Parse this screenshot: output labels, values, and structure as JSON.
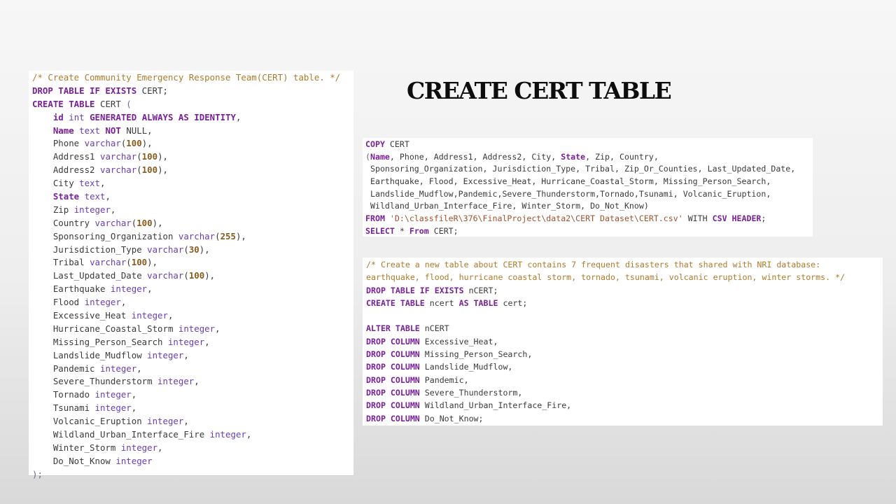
{
  "title": "CREATE CERT TABLE",
  "colors": {
    "keyword": "#7a1f9c",
    "comment": "#b07a2a",
    "type": "#6a3db8",
    "number": "#8a5a1a",
    "plain": "#3b3b3b",
    "string": "#a0522d"
  },
  "panels": [
    {
      "name": "create-table-code",
      "lines": [
        [
          {
            "t": "/* Create Community Emergency Response Team(CERT) table. */",
            "c": "cm"
          }
        ],
        [
          {
            "t": "DROP TABLE IF EXISTS",
            "c": "kw"
          },
          {
            "t": " CERT;",
            "c": "pl"
          }
        ],
        [
          {
            "t": "CREATE TABLE",
            "c": "kw"
          },
          {
            "t": " CERT ",
            "c": "pl"
          },
          {
            "t": "(",
            "c": "pn"
          }
        ],
        [
          {
            "t": "    ",
            "c": "pl"
          },
          {
            "t": "id",
            "c": "kw"
          },
          {
            "t": " ",
            "c": "pl"
          },
          {
            "t": "int",
            "c": "ty"
          },
          {
            "t": " ",
            "c": "pl"
          },
          {
            "t": "GENERATED ALWAYS AS IDENTITY",
            "c": "kw"
          },
          {
            "t": ",",
            "c": "pl"
          }
        ],
        [
          {
            "t": "    ",
            "c": "pl"
          },
          {
            "t": "Name",
            "c": "kw"
          },
          {
            "t": " ",
            "c": "pl"
          },
          {
            "t": "text",
            "c": "ty"
          },
          {
            "t": " ",
            "c": "pl"
          },
          {
            "t": "NOT",
            "c": "kw"
          },
          {
            "t": " NULL,",
            "c": "pl"
          }
        ],
        [
          {
            "t": "    Phone ",
            "c": "pl"
          },
          {
            "t": "varchar",
            "c": "ty"
          },
          {
            "t": "(",
            "c": "pl"
          },
          {
            "t": "100",
            "c": "nm"
          },
          {
            "t": "),",
            "c": "pl"
          }
        ],
        [
          {
            "t": "    Address1 ",
            "c": "pl"
          },
          {
            "t": "varchar",
            "c": "ty"
          },
          {
            "t": "(",
            "c": "pl"
          },
          {
            "t": "100",
            "c": "nm"
          },
          {
            "t": "),",
            "c": "pl"
          }
        ],
        [
          {
            "t": "    Address2 ",
            "c": "pl"
          },
          {
            "t": "varchar",
            "c": "ty"
          },
          {
            "t": "(",
            "c": "pl"
          },
          {
            "t": "100",
            "c": "nm"
          },
          {
            "t": "),",
            "c": "pl"
          }
        ],
        [
          {
            "t": "    City ",
            "c": "pl"
          },
          {
            "t": "text",
            "c": "ty"
          },
          {
            "t": ",",
            "c": "pl"
          }
        ],
        [
          {
            "t": "    ",
            "c": "pl"
          },
          {
            "t": "State",
            "c": "kw"
          },
          {
            "t": " ",
            "c": "pl"
          },
          {
            "t": "text",
            "c": "ty"
          },
          {
            "t": ",",
            "c": "pl"
          }
        ],
        [
          {
            "t": "    Zip ",
            "c": "pl"
          },
          {
            "t": "integer",
            "c": "ty"
          },
          {
            "t": ",",
            "c": "pl"
          }
        ],
        [
          {
            "t": "    Country ",
            "c": "pl"
          },
          {
            "t": "varchar",
            "c": "ty"
          },
          {
            "t": "(",
            "c": "pl"
          },
          {
            "t": "100",
            "c": "nm"
          },
          {
            "t": "),",
            "c": "pl"
          }
        ],
        [
          {
            "t": "    Sponsoring_Organization ",
            "c": "pl"
          },
          {
            "t": "varchar",
            "c": "ty"
          },
          {
            "t": "(",
            "c": "pl"
          },
          {
            "t": "255",
            "c": "nm"
          },
          {
            "t": "),",
            "c": "pl"
          }
        ],
        [
          {
            "t": "    Jurisdiction_Type ",
            "c": "pl"
          },
          {
            "t": "varchar",
            "c": "ty"
          },
          {
            "t": "(",
            "c": "pl"
          },
          {
            "t": "30",
            "c": "nm"
          },
          {
            "t": "),",
            "c": "pl"
          }
        ],
        [
          {
            "t": "    Tribal ",
            "c": "pl"
          },
          {
            "t": "varchar",
            "c": "ty"
          },
          {
            "t": "(",
            "c": "pl"
          },
          {
            "t": "100",
            "c": "nm"
          },
          {
            "t": "),",
            "c": "pl"
          }
        ],
        [
          {
            "t": "    Last_Updated_Date ",
            "c": "pl"
          },
          {
            "t": "varchar",
            "c": "ty"
          },
          {
            "t": "(",
            "c": "pl"
          },
          {
            "t": "100",
            "c": "nm"
          },
          {
            "t": "),",
            "c": "pl"
          }
        ],
        [
          {
            "t": "    Earthquake ",
            "c": "pl"
          },
          {
            "t": "integer",
            "c": "ty"
          },
          {
            "t": ",",
            "c": "pl"
          }
        ],
        [
          {
            "t": "    Flood ",
            "c": "pl"
          },
          {
            "t": "integer",
            "c": "ty"
          },
          {
            "t": ",",
            "c": "pl"
          }
        ],
        [
          {
            "t": "    Excessive_Heat ",
            "c": "pl"
          },
          {
            "t": "integer",
            "c": "ty"
          },
          {
            "t": ",",
            "c": "pl"
          }
        ],
        [
          {
            "t": "    Hurricane_Coastal_Storm ",
            "c": "pl"
          },
          {
            "t": "integer",
            "c": "ty"
          },
          {
            "t": ",",
            "c": "pl"
          }
        ],
        [
          {
            "t": "    Missing_Person_Search ",
            "c": "pl"
          },
          {
            "t": "integer",
            "c": "ty"
          },
          {
            "t": ",",
            "c": "pl"
          }
        ],
        [
          {
            "t": "    Landslide_Mudflow ",
            "c": "pl"
          },
          {
            "t": "integer",
            "c": "ty"
          },
          {
            "t": ",",
            "c": "pl"
          }
        ],
        [
          {
            "t": "    Pandemic ",
            "c": "pl"
          },
          {
            "t": "integer",
            "c": "ty"
          },
          {
            "t": ",",
            "c": "pl"
          }
        ],
        [
          {
            "t": "    Severe_Thunderstorm ",
            "c": "pl"
          },
          {
            "t": "integer",
            "c": "ty"
          },
          {
            "t": ",",
            "c": "pl"
          }
        ],
        [
          {
            "t": "    Tornado ",
            "c": "pl"
          },
          {
            "t": "integer",
            "c": "ty"
          },
          {
            "t": ",",
            "c": "pl"
          }
        ],
        [
          {
            "t": "    Tsunami ",
            "c": "pl"
          },
          {
            "t": "integer",
            "c": "ty"
          },
          {
            "t": ",",
            "c": "pl"
          }
        ],
        [
          {
            "t": "    Volcanic_Eruption ",
            "c": "pl"
          },
          {
            "t": "integer",
            "c": "ty"
          },
          {
            "t": ",",
            "c": "pl"
          }
        ],
        [
          {
            "t": "    Wildland_Urban_Interface_Fire ",
            "c": "pl"
          },
          {
            "t": "integer",
            "c": "ty"
          },
          {
            "t": ",",
            "c": "pl"
          }
        ],
        [
          {
            "t": "    Winter_Storm ",
            "c": "pl"
          },
          {
            "t": "integer",
            "c": "ty"
          },
          {
            "t": ",",
            "c": "pl"
          }
        ],
        [
          {
            "t": "    Do_Not_Know ",
            "c": "pl"
          },
          {
            "t": "integer",
            "c": "ty"
          }
        ],
        [
          {
            "t": ");",
            "c": "pn"
          }
        ]
      ]
    },
    {
      "name": "copy-code",
      "lines": [
        [
          {
            "t": "COPY",
            "c": "kw"
          },
          {
            "t": " CERT",
            "c": "pl"
          }
        ],
        [
          {
            "t": "(",
            "c": "pn"
          },
          {
            "t": "Name",
            "c": "kw"
          },
          {
            "t": ", Phone, Address1, Address2, City, ",
            "c": "pl"
          },
          {
            "t": "State",
            "c": "kw"
          },
          {
            "t": ", Zip, Country,",
            "c": "pl"
          }
        ],
        [
          {
            "t": " Sponsoring_Organization, Jurisdiction_Type, Tribal, Zip_Or_Counties, Last_Updated_Date,",
            "c": "pl"
          }
        ],
        [
          {
            "t": " Earthquake, Flood, Excessive_Heat, Hurricane_Coastal_Storm, Missing_Person_Search,",
            "c": "pl"
          }
        ],
        [
          {
            "t": " Landslide_Mudflow,Pandemic,Severe_Thunderstorm,Tornado,Tsunami, Volcanic_Eruption,",
            "c": "pl"
          }
        ],
        [
          {
            "t": " Wildland_Urban_Interface_Fire, Winter_Storm, Do_Not_Know)",
            "c": "pl"
          }
        ],
        [
          {
            "t": "FROM",
            "c": "kw"
          },
          {
            "t": " ",
            "c": "pl"
          },
          {
            "t": "'D:\\classfileR\\376\\FinalProject\\data2\\CERT Dataset\\CERT.csv'",
            "c": "st"
          },
          {
            "t": " WITH ",
            "c": "pl"
          },
          {
            "t": "CSV HEADER",
            "c": "kw"
          },
          {
            "t": ";",
            "c": "pl"
          }
        ],
        [
          {
            "t": "SELECT",
            "c": "kw"
          },
          {
            "t": " * ",
            "c": "pl"
          },
          {
            "t": "From",
            "c": "kw"
          },
          {
            "t": " CERT;",
            "c": "pl"
          }
        ]
      ]
    },
    {
      "name": "alter-table-code",
      "lines": [
        [
          {
            "t": "/* Create a new table about CERT contains 7 frequent disasters that shared with NRI database:",
            "c": "cm"
          }
        ],
        [
          {
            "t": "earthquake, flood, hurricane coastal storm, tornado, tsunami, volcanic eruption, winter storms. */",
            "c": "cm"
          }
        ],
        [
          {
            "t": "DROP TABLE IF EXISTS",
            "c": "kw"
          },
          {
            "t": " nCERT;",
            "c": "pl"
          }
        ],
        [
          {
            "t": "CREATE TABLE",
            "c": "kw"
          },
          {
            "t": " ncert ",
            "c": "pl"
          },
          {
            "t": "AS TABLE",
            "c": "kw"
          },
          {
            "t": " cert;",
            "c": "pl"
          }
        ],
        [
          {
            "t": " ",
            "c": "pl"
          }
        ],
        [
          {
            "t": "ALTER TABLE",
            "c": "kw"
          },
          {
            "t": " nCERT",
            "c": "pl"
          }
        ],
        [
          {
            "t": "DROP COLUMN",
            "c": "kw"
          },
          {
            "t": " Excessive_Heat,",
            "c": "pl"
          }
        ],
        [
          {
            "t": "DROP COLUMN",
            "c": "kw"
          },
          {
            "t": " Missing_Person_Search,",
            "c": "pl"
          }
        ],
        [
          {
            "t": "DROP COLUMN",
            "c": "kw"
          },
          {
            "t": " Landslide_Mudflow,",
            "c": "pl"
          }
        ],
        [
          {
            "t": "DROP COLUMN",
            "c": "kw"
          },
          {
            "t": " Pandemic,",
            "c": "pl"
          }
        ],
        [
          {
            "t": "DROP COLUMN",
            "c": "kw"
          },
          {
            "t": " Severe_Thunderstorm,",
            "c": "pl"
          }
        ],
        [
          {
            "t": "DROP COLUMN",
            "c": "kw"
          },
          {
            "t": " Wildland_Urban_Interface_Fire,",
            "c": "pl"
          }
        ],
        [
          {
            "t": "DROP COLUMN",
            "c": "kw"
          },
          {
            "t": " Do_Not_Know;",
            "c": "pl"
          }
        ]
      ]
    }
  ]
}
